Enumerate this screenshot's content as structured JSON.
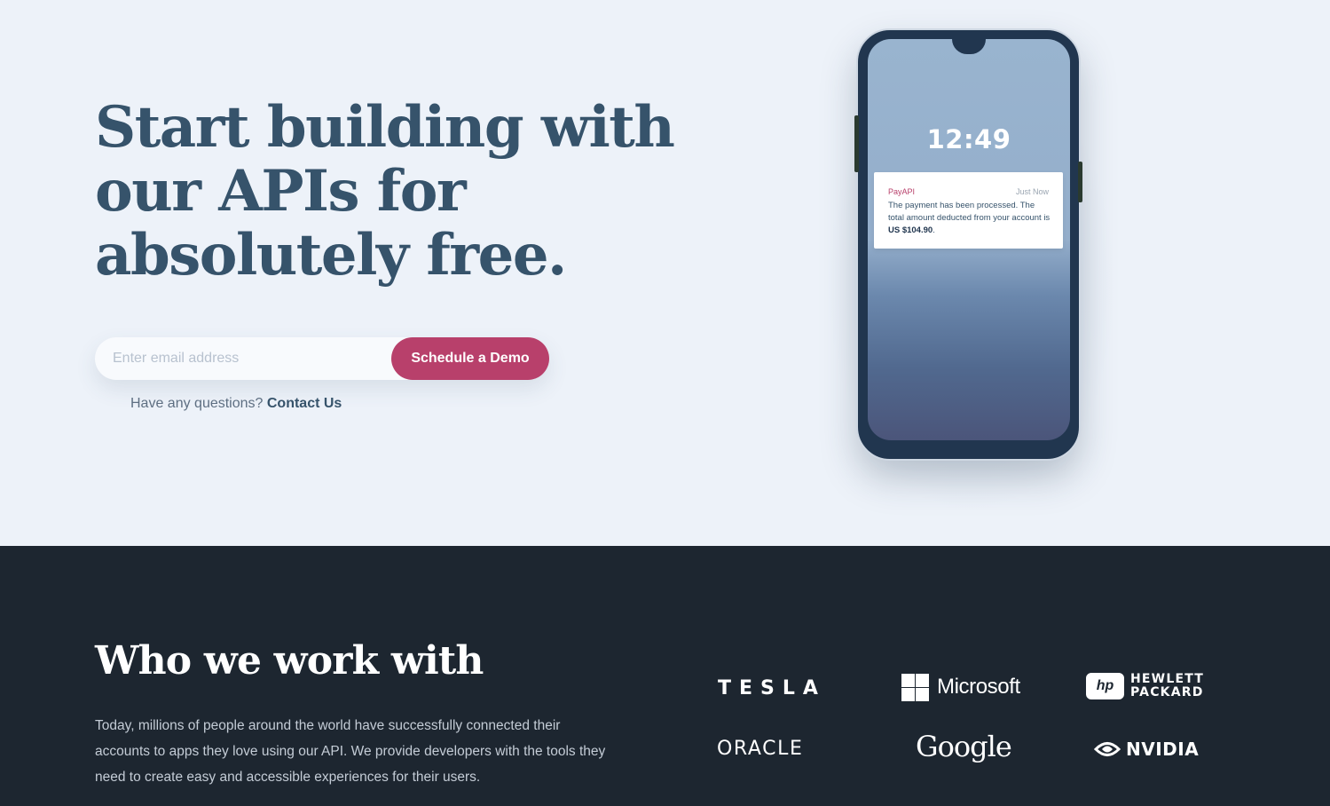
{
  "hero": {
    "title_lines": [
      "Start building with",
      "our APIs for",
      "absolutely free."
    ],
    "email_placeholder": "Enter email address",
    "cta_label": "Schedule a Demo",
    "question_text": "Have any questions? ",
    "contact_label": "Contact Us"
  },
  "phone": {
    "time": "12:49",
    "notification": {
      "app": "PayAPI",
      "time": "Just Now",
      "message": "The payment has been processed. The total amount deducted from your account is ",
      "amount": "US $104.90",
      "period": "."
    }
  },
  "partners": {
    "title": "Who we work with",
    "description": "Today, millions of people around the world have successfully connected their accounts to apps they love using our API. We provide developers with the tools they need to create easy and accessible experiences for their users.",
    "logos": {
      "tesla": "TESLA",
      "microsoft": "Microsoft",
      "hp_mark": "hp",
      "hp_line1": "HEWLETT",
      "hp_line2": "PACKARD",
      "oracle": "ORACLE",
      "google": "Google",
      "nvidia": "NVIDIA"
    }
  },
  "colors": {
    "accent": "#b8406b",
    "heading": "#36536b",
    "dark_bg": "#1d2630",
    "hero_bg": "#edf2f9"
  }
}
